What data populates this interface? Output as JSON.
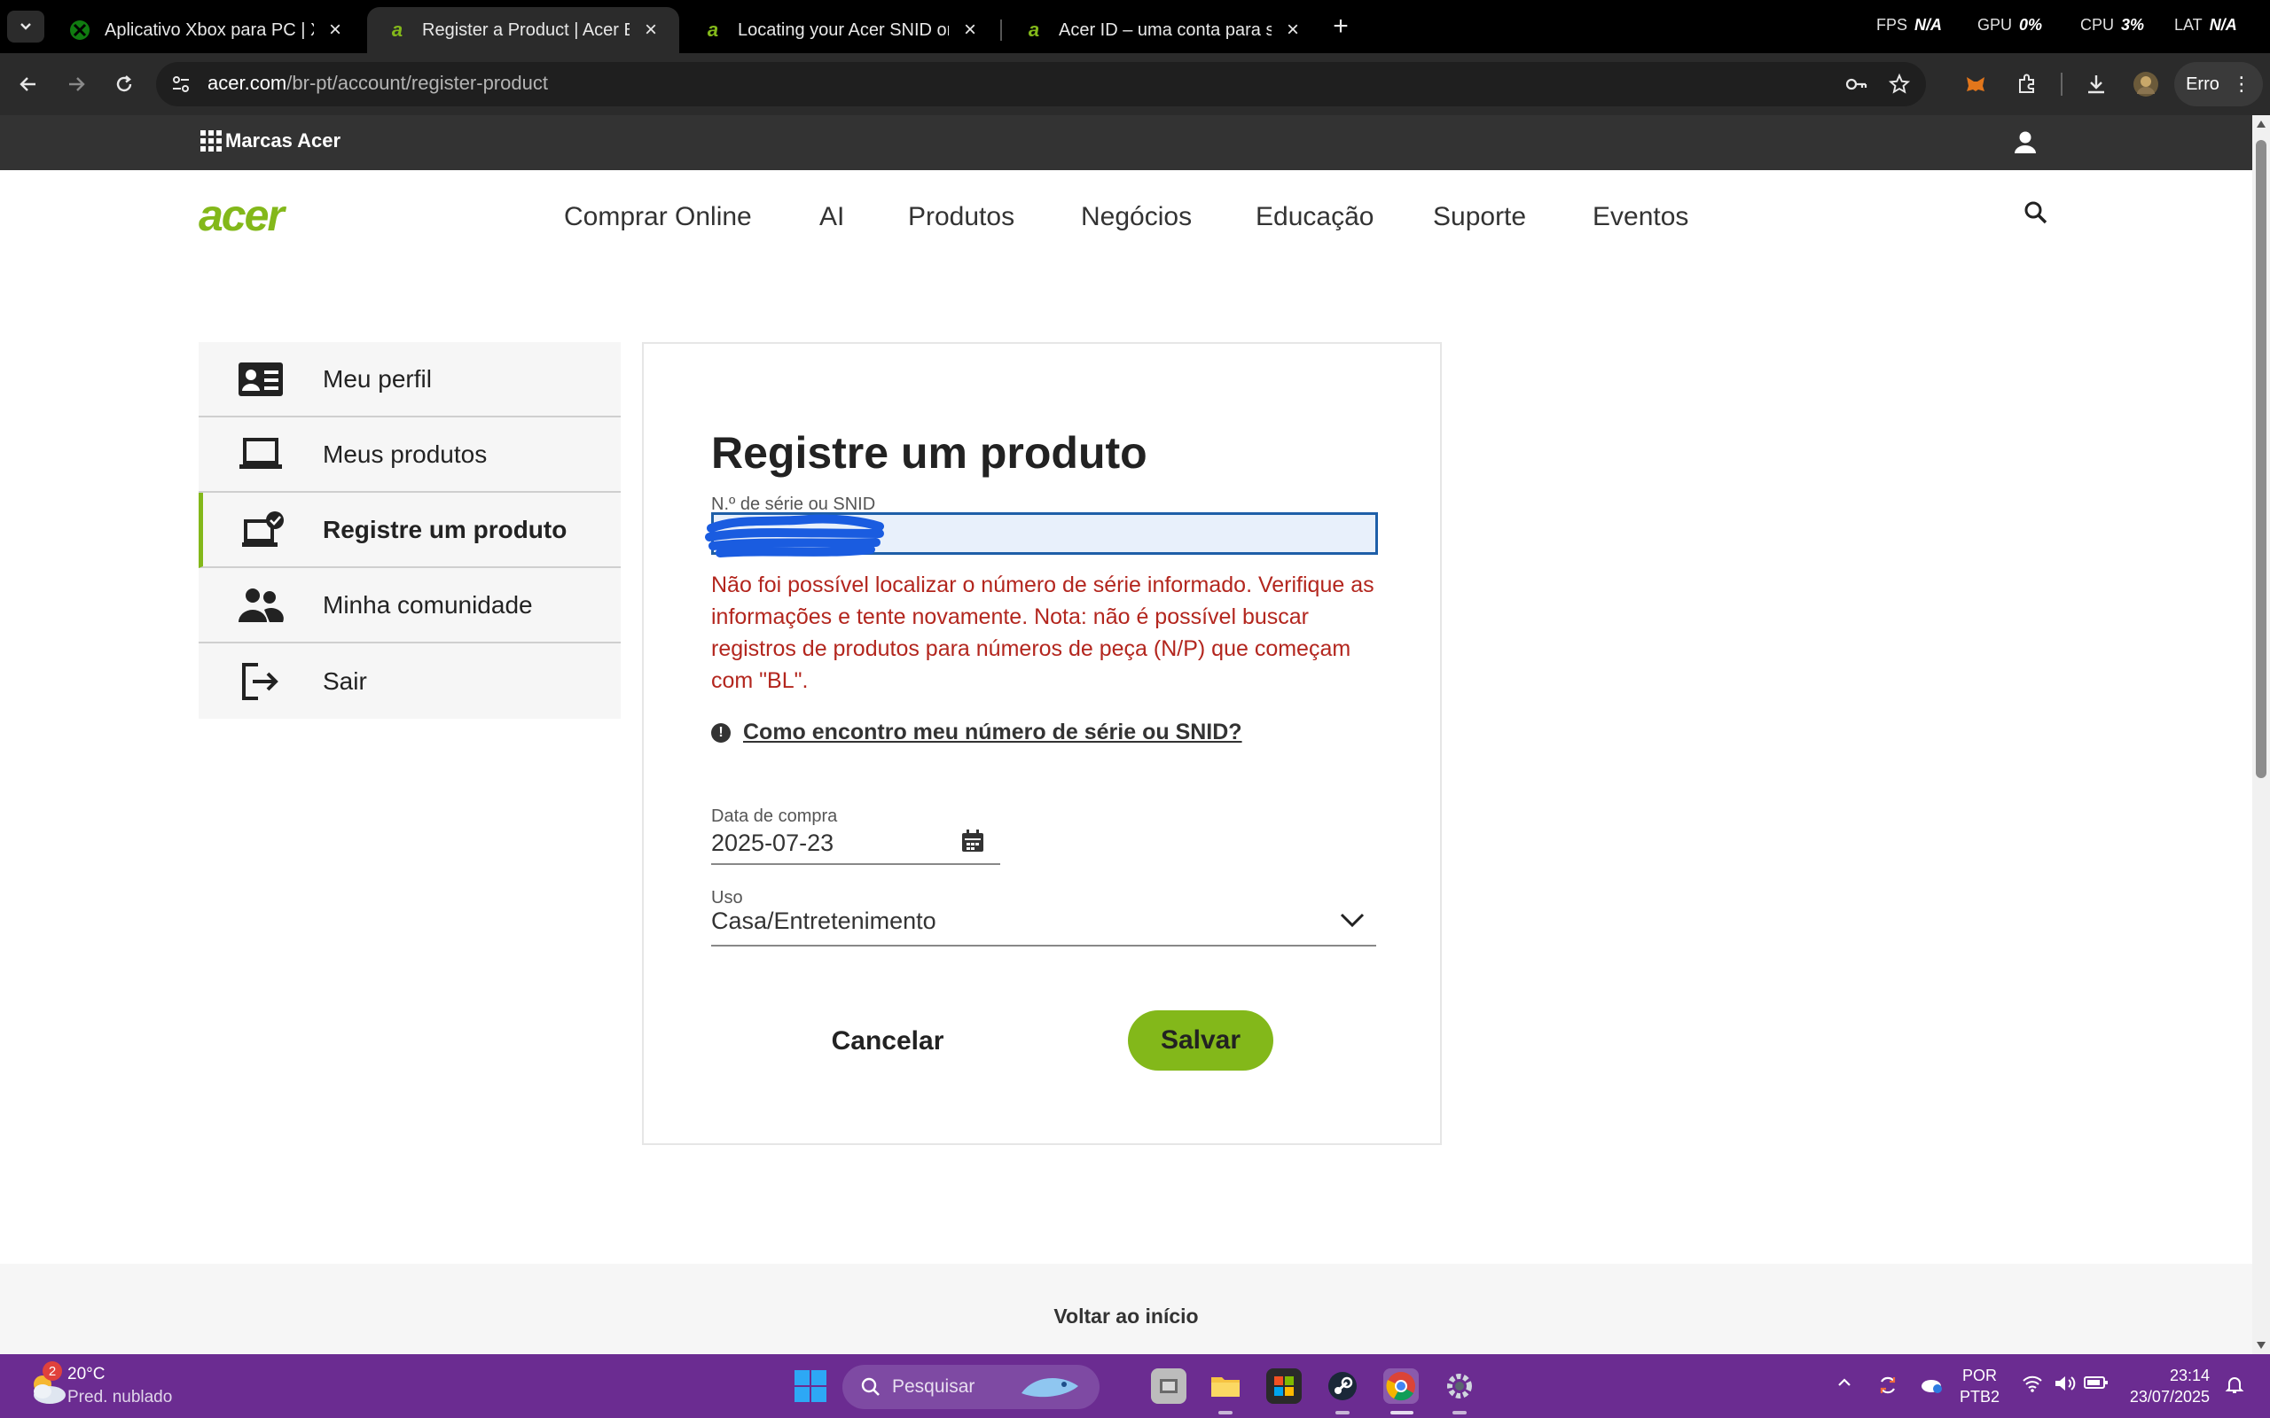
{
  "browser": {
    "tabs": [
      {
        "title": "Aplicativo Xbox para PC | Xbox",
        "favicon": "xbox-icon",
        "active": false
      },
      {
        "title": "Register a Product | Acer Estado",
        "favicon": "acer-icon",
        "active": true
      },
      {
        "title": "Locating your Acer SNID or Ser",
        "favicon": "acer-icon",
        "active": false
      },
      {
        "title": "Acer ID – uma conta para seus d",
        "favicon": "acer-icon",
        "active": false
      }
    ],
    "perf": {
      "fps_label": "FPS",
      "fps_value": "N/A",
      "gpu_label": "GPU",
      "gpu_value": "0%",
      "cpu_label": "CPU",
      "cpu_value": "3%",
      "lat_label": "LAT",
      "lat_value": "N/A"
    },
    "url_domain": "acer.com",
    "url_path": "/br-pt/account/register-product",
    "profile_status": "Erro"
  },
  "brandbar": {
    "label": "Marcas Acer"
  },
  "nav": {
    "logo": "acer",
    "items": [
      "Comprar Online",
      "AI",
      "Produtos",
      "Negócios",
      "Educação",
      "Suporte",
      "Eventos"
    ]
  },
  "sidebar": {
    "items": [
      {
        "label": "Meu perfil",
        "icon": "profile-card-icon"
      },
      {
        "label": "Meus produtos",
        "icon": "laptop-icon"
      },
      {
        "label": "Registre um produto",
        "icon": "laptop-check-icon",
        "active": true
      },
      {
        "label": "Minha comunidade",
        "icon": "community-icon"
      },
      {
        "label": "Sair",
        "icon": "logout-icon"
      }
    ]
  },
  "form": {
    "title": "Registre um produto",
    "serial_label": "N.º de série ou SNID",
    "serial_value": "",
    "error": "Não foi possível localizar o número de série informado. Verifique as informações e tente novamente. Nota: não é possível buscar registros de produtos para números de peça (N/P) que começam com \"BL\".",
    "help_link": "Como encontro meu número de série ou SNID?",
    "date_label": "Data de compra",
    "date_value": "2025-07-23",
    "use_label": "Uso",
    "use_value": "Casa/Entretenimento",
    "cancel_label": "Cancelar",
    "save_label": "Salvar"
  },
  "footer": {
    "back_to_top": "Voltar ao início"
  },
  "taskbar": {
    "weather_badge": "2",
    "weather_temp": "20°C",
    "weather_desc": "Pred. nublado",
    "search_placeholder": "Pesquisar",
    "lang_line1": "POR",
    "lang_line2": "PTB2",
    "time": "23:14",
    "date": "23/07/2025"
  },
  "colors": {
    "acer_green": "#83b81a",
    "error_red": "#b3261e",
    "taskbar_purple": "#6b2c91"
  }
}
